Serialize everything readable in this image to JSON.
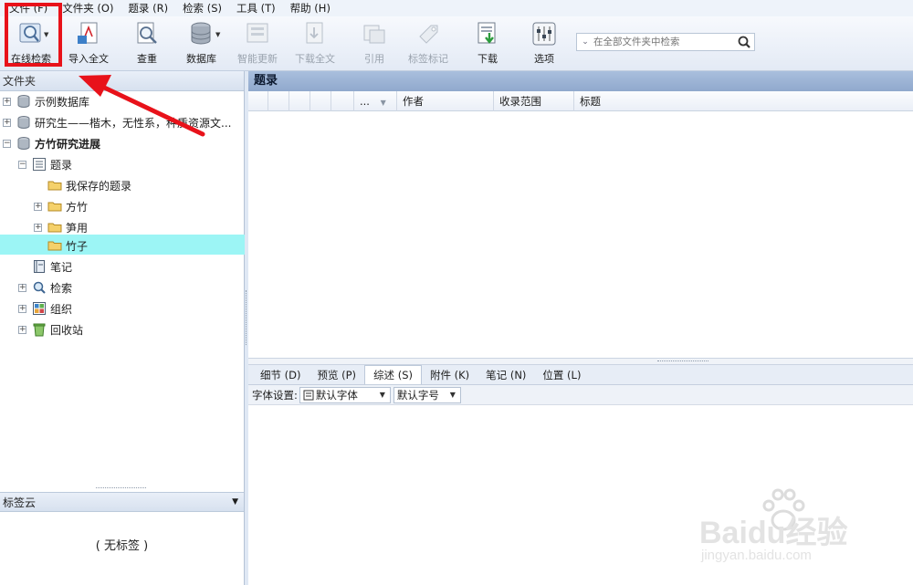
{
  "menu": [
    "文件 (F)",
    "文件夹 (O)",
    "题录 (R)",
    "检索 (S)",
    "工具 (T)",
    "帮助 (H)"
  ],
  "toolbar": {
    "online_search": "在线检索",
    "import_fulltext": "导入全文",
    "dedupe": "查重",
    "database": "数据库",
    "smart_update": "智能更新",
    "download_fulltext": "下载全文",
    "cite": "引用",
    "tag_mark": "标签标记",
    "download": "下载",
    "options": "选项"
  },
  "search": {
    "placeholder": "在全部文件夹中检索"
  },
  "folder_pane": {
    "title": "文件夹"
  },
  "tree": [
    {
      "label": "示例数据库",
      "icon": "database-icon",
      "expand": "+"
    },
    {
      "label": "研究生——楷木，无性系，种质资源文...",
      "icon": "database-icon",
      "expand": "+"
    },
    {
      "label": "方竹研究进展",
      "icon": "database-icon",
      "expand": "−"
    },
    {
      "label": "题录",
      "icon": "list-icon",
      "expand": "−"
    },
    {
      "label": "我保存的题录",
      "icon": "folder-icon",
      "expand": ""
    },
    {
      "label": "方竹",
      "icon": "folder-icon",
      "expand": "+"
    },
    {
      "label": "笋用",
      "icon": "folder-icon",
      "expand": "+"
    },
    {
      "label": "竹子",
      "icon": "folder-icon",
      "expand": ""
    },
    {
      "label": "笔记",
      "icon": "notebook-icon",
      "expand": ""
    },
    {
      "label": "检索",
      "icon": "search-icon",
      "expand": "+"
    },
    {
      "label": "组织",
      "icon": "grid-icon",
      "expand": "+"
    },
    {
      "label": "回收站",
      "icon": "recycle-icon",
      "expand": "+"
    }
  ],
  "tag_cloud": {
    "title": "标签云",
    "empty": "( 无标签 )"
  },
  "list": {
    "title": "题录",
    "columns": [
      "...",
      "作者",
      "收录范围",
      "标题"
    ]
  },
  "tabs": [
    "细节 (D)",
    "预览 (P)",
    "综述 (S)",
    "附件 (K)",
    "笔记 (N)",
    "位置 (L)"
  ],
  "font_settings": {
    "label": "字体设置:",
    "font": "默认字体",
    "size": "默认字号"
  },
  "watermark": {
    "brand": "Baidu经验",
    "url": "jingyan.baidu.com"
  }
}
